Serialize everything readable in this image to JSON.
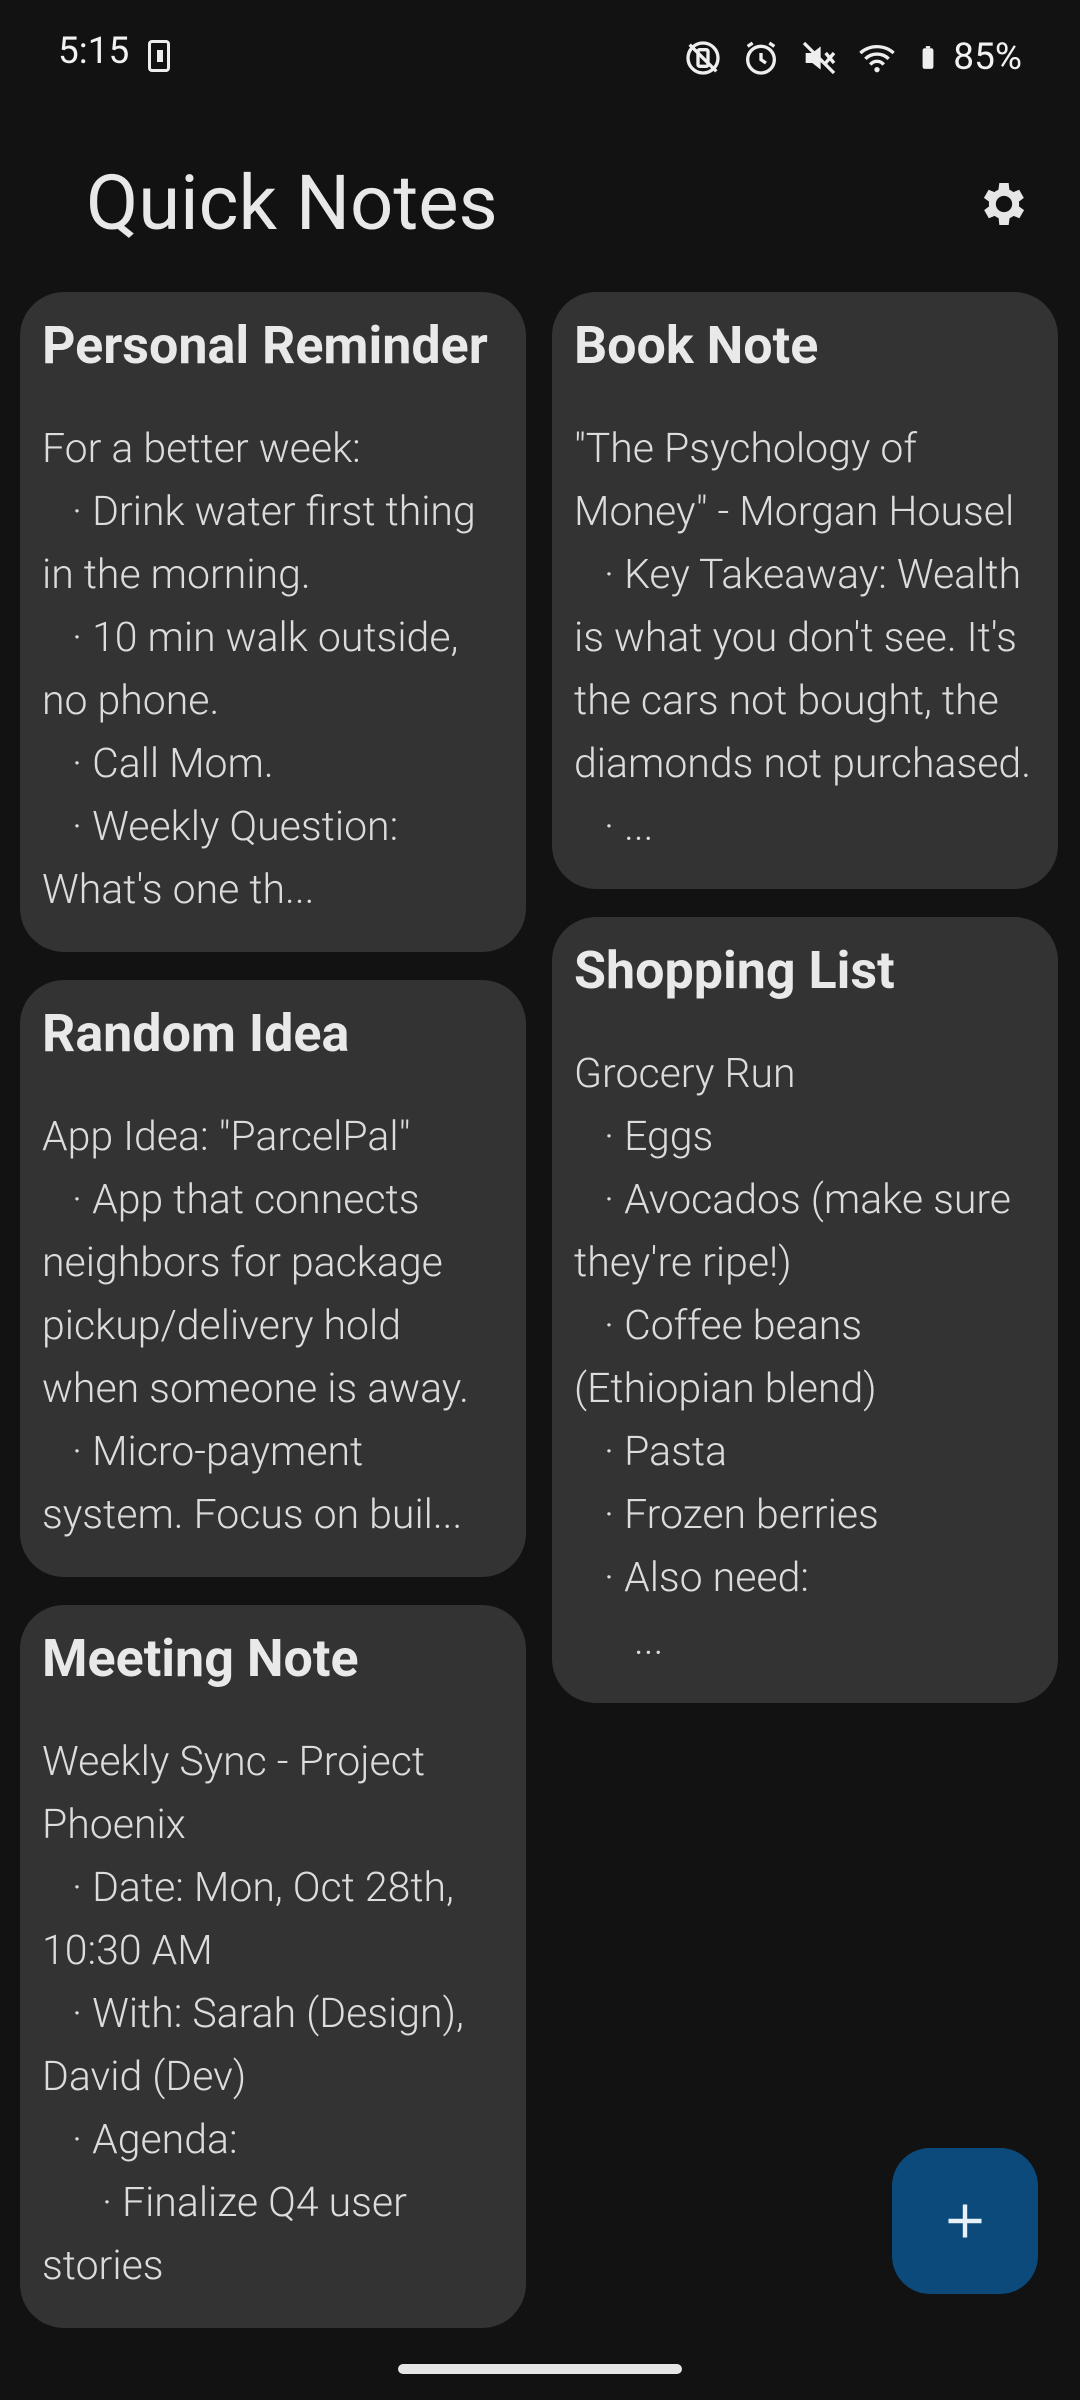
{
  "status": {
    "time": "5:15",
    "battery": "85%"
  },
  "app": {
    "title": "Quick Notes"
  },
  "notes_left": [
    {
      "title": "Personal Reminder",
      "body": "For a better week:\n   · Drink water first thing in the morning.\n   · 10 min walk outside, no phone.\n   · Call Mom.\n   · Weekly Question: What's one th..."
    },
    {
      "title": "Random Idea",
      "body": "App Idea: \"ParcelPal\"\n   · App that connects neighbors for package pickup/delivery hold when someone is away.\n   · Micro-payment system. Focus on buil..."
    },
    {
      "title": "Meeting Note",
      "body": "Weekly Sync - Project Phoenix\n   · Date: Mon, Oct 28th, 10:30 AM\n   · With: Sarah (Design), David (Dev)\n   · Agenda:\n      · Finalize Q4 user stories"
    }
  ],
  "notes_right": [
    {
      "title": "Book Note",
      "body": "\"The Psychology of Money\" - Morgan Housel\n   · Key Takeaway: Wealth is what you don't see. It's the cars not bought, the diamonds not purchased.\n   · ..."
    },
    {
      "title": "Shopping List",
      "body": "Grocery Run\n   · Eggs\n   · Avocados (make sure they're ripe!)\n   · Coffee beans (Ethiopian blend)\n   · Pasta\n   · Frozen berries\n   · Also need:\n      ..."
    }
  ],
  "fab": {
    "icon": "plus-icon"
  },
  "colors": {
    "background": "#121212",
    "card": "#333333",
    "fab": "#0b4a7a"
  }
}
